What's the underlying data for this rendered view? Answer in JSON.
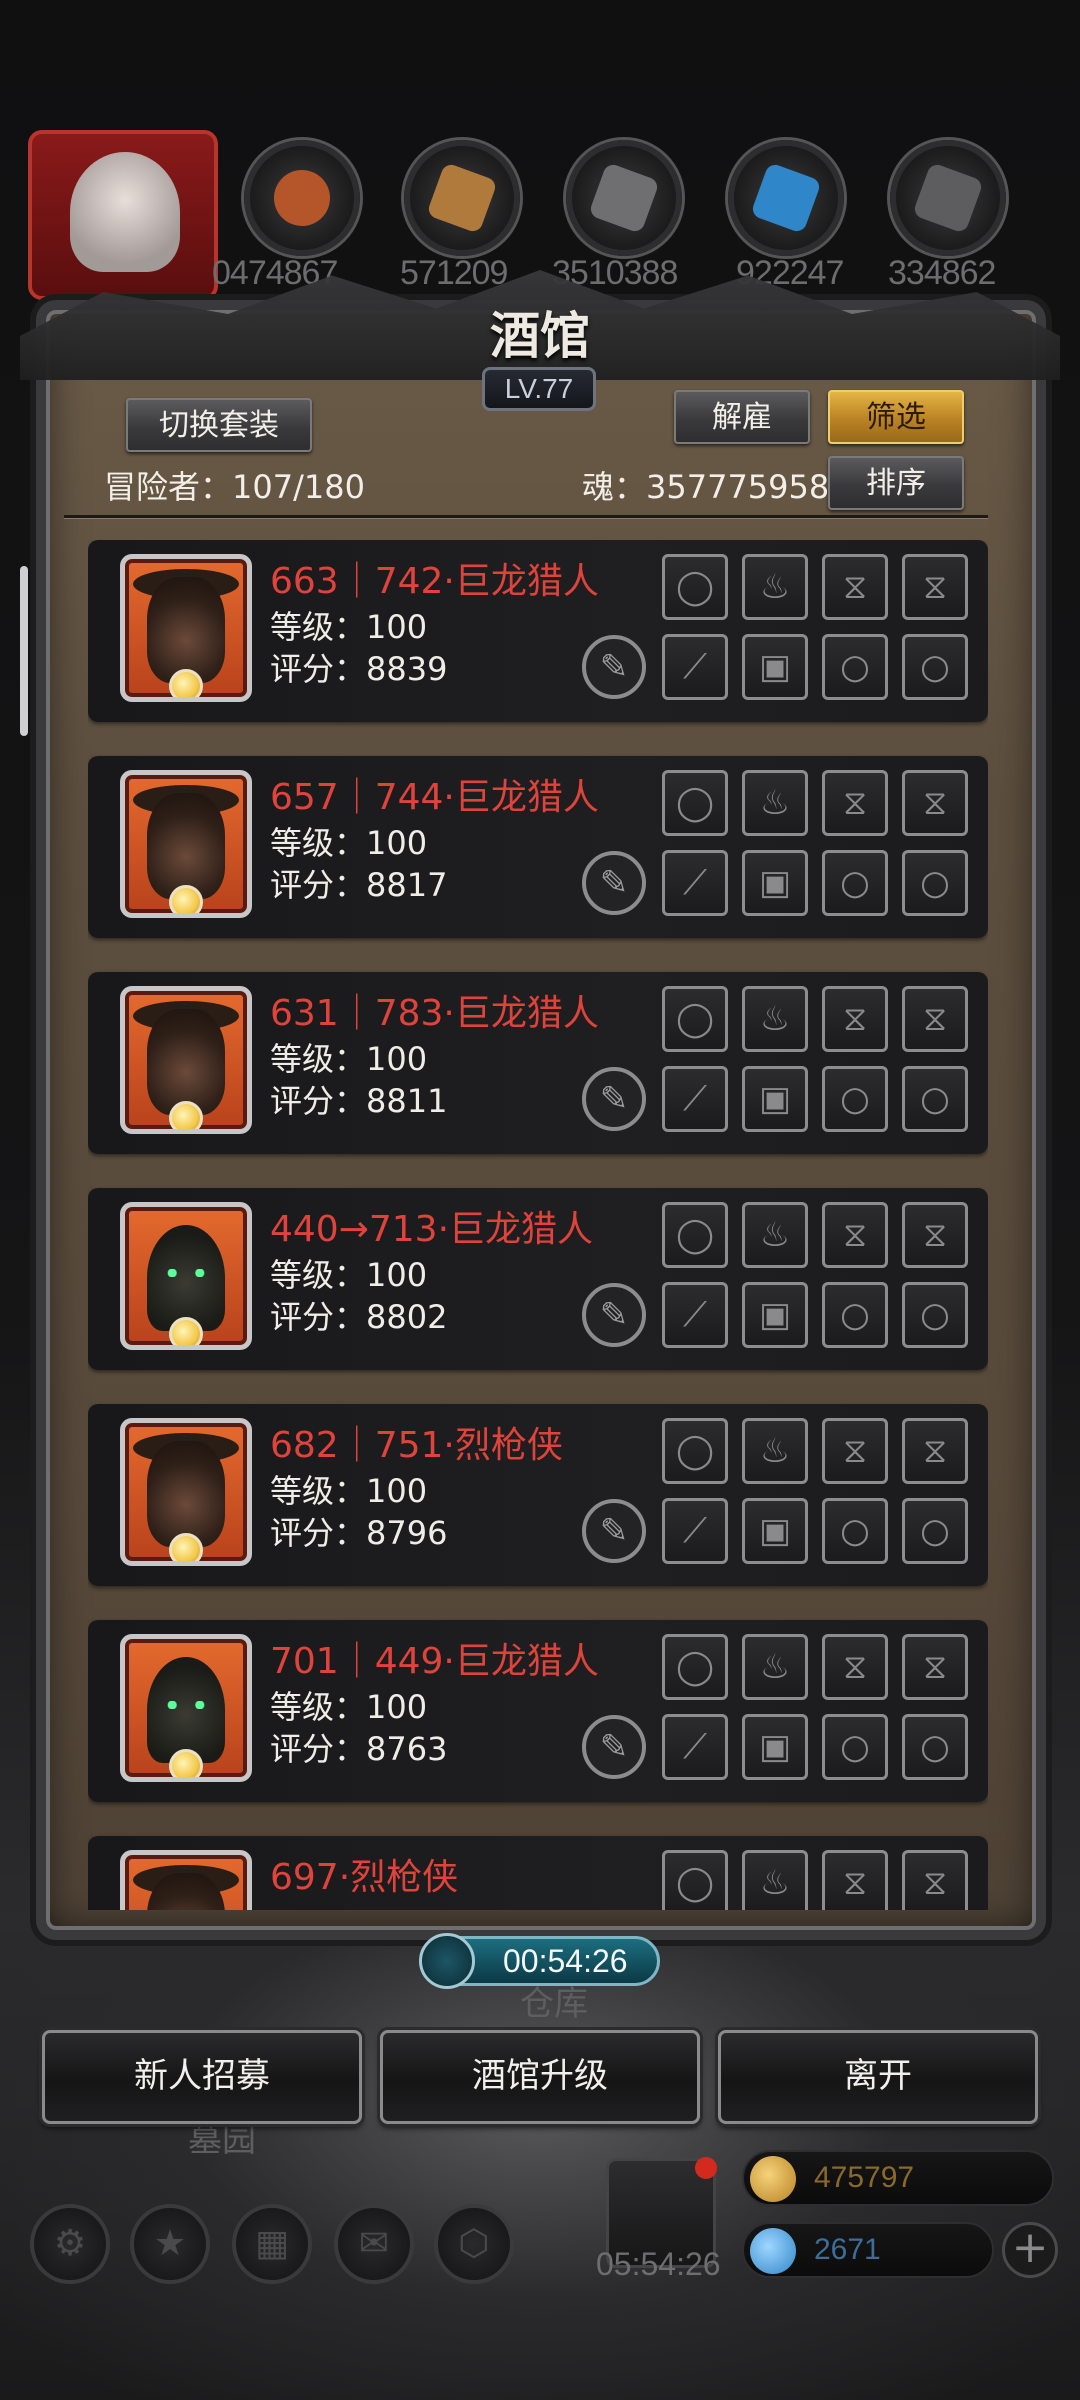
{
  "resources": [
    {
      "value": "0474867",
      "icon": "meat-icon",
      "color": "#b5562a"
    },
    {
      "value": "571209",
      "icon": "wood-icon",
      "color": "#b07a3d"
    },
    {
      "value": "3510388",
      "icon": "iron-icon",
      "color": "#6f6f72"
    },
    {
      "value": "922247",
      "icon": "crystal-icon",
      "color": "#2f86c8"
    },
    {
      "value": "334862",
      "icon": "stone-icon",
      "color": "#5d5d60"
    }
  ],
  "tavern": {
    "title": "酒馆",
    "level": "LV.77",
    "switch_outfit_label": "切换套装",
    "dismiss_label": "解雇",
    "filter_label": "筛选",
    "sort_label": "排序",
    "adventurers": "冒险者：107/180",
    "soul": "魂：357775958"
  },
  "heroes": [
    {
      "name": "663｜742·巨龙猎人",
      "level": "等级：100",
      "score": "评分：8839",
      "portrait": "hat-hunter"
    },
    {
      "name": "657｜744·巨龙猎人",
      "level": "等级：100",
      "score": "评分：8817",
      "portrait": "hat-hunter"
    },
    {
      "name": "631｜783·巨龙猎人",
      "level": "等级：100",
      "score": "评分：8811",
      "portrait": "hat-hunter"
    },
    {
      "name": "440→713·巨龙猎人",
      "level": "等级：100",
      "score": "评分：8802",
      "portrait": "hooded"
    },
    {
      "name": "682｜751·烈枪侠",
      "level": "等级：100",
      "score": "评分：8796",
      "portrait": "hat-hunter"
    },
    {
      "name": "701｜449·巨龙猎人",
      "level": "等级：100",
      "score": "评分：8763",
      "portrait": "hooded"
    },
    {
      "name": "697·烈枪侠",
      "level": "",
      "score": "",
      "portrait": "hat-hunter"
    }
  ],
  "equipment_slots": [
    [
      "amulet-icon",
      "flame-icon",
      "hourglass-icon",
      "hourglass-icon"
    ],
    [
      "scythe-icon",
      "armor-icon",
      "ring-icon",
      "ring-icon"
    ]
  ],
  "bottom": {
    "timer": "00:54:26",
    "warehouse_label": "仓库",
    "cemetery_label": "墓园",
    "recruit_label": "新人招募",
    "upgrade_label": "酒馆升级",
    "leave_label": "离开",
    "gift_timer": "05:54:26",
    "gold": "475797",
    "gems": "2671"
  }
}
